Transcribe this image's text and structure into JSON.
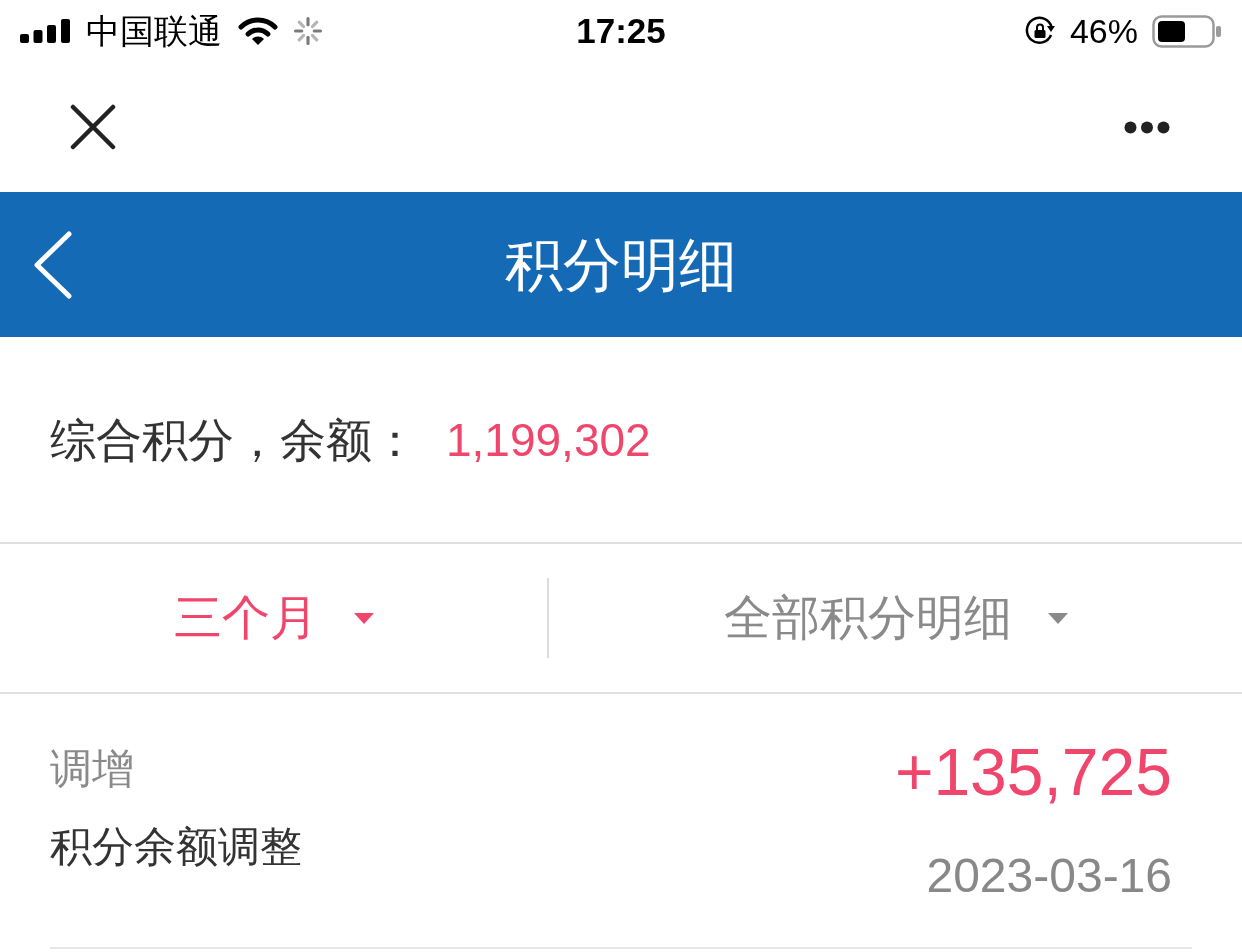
{
  "status_bar": {
    "carrier": "中国联通",
    "time": "17:25",
    "battery": "46%"
  },
  "header": {
    "title": "积分明细"
  },
  "balance": {
    "label": "综合积分，余额：",
    "value": "1,199,302"
  },
  "filters": [
    {
      "label": "三个月",
      "selected": true
    },
    {
      "label": "全部积分明细",
      "selected": false
    }
  ],
  "records": [
    {
      "type": "调增",
      "description": "积分余额调整",
      "amount": "+135,725",
      "date": "2023-03-16"
    }
  ]
}
